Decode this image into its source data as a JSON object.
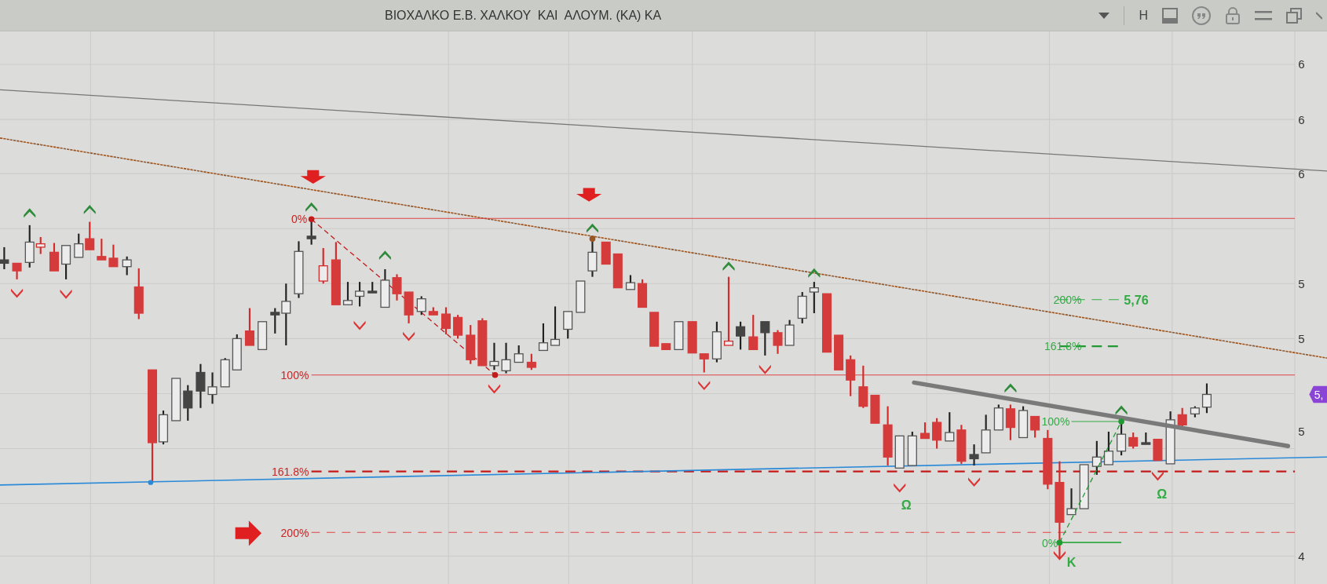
{
  "toolbar": {
    "title": "ΒΙΟΧΑΛΚΟ Ε.Β. ΧΑΛΚΟΥ  ΚΑΙ  ΑΛΟΥΜ. (ΚΑ) ΚΑ",
    "h_label": "H"
  },
  "chart": {
    "fib_labels": [
      {
        "text": "0%",
        "color": "#cc2222"
      },
      {
        "text": "100%",
        "color": "#cc2222"
      },
      {
        "text": "161.8%",
        "color": "#cc2222"
      },
      {
        "text": "200%",
        "color": "#cc2222"
      },
      {
        "text": "200%",
        "color": "#33aa44"
      },
      {
        "text": "161.8%",
        "color": "#33aa44"
      },
      {
        "text": "100%",
        "color": "#33aa44"
      },
      {
        "text": "0%",
        "color": "#33aa44"
      }
    ],
    "target_value": "5,76",
    "wave_labels": [
      "Ω",
      "Ω",
      "K"
    ],
    "axis_labels": [
      "6",
      "6",
      "6",
      "5",
      "5",
      "5",
      "4"
    ],
    "price_badge": "5,"
  }
}
